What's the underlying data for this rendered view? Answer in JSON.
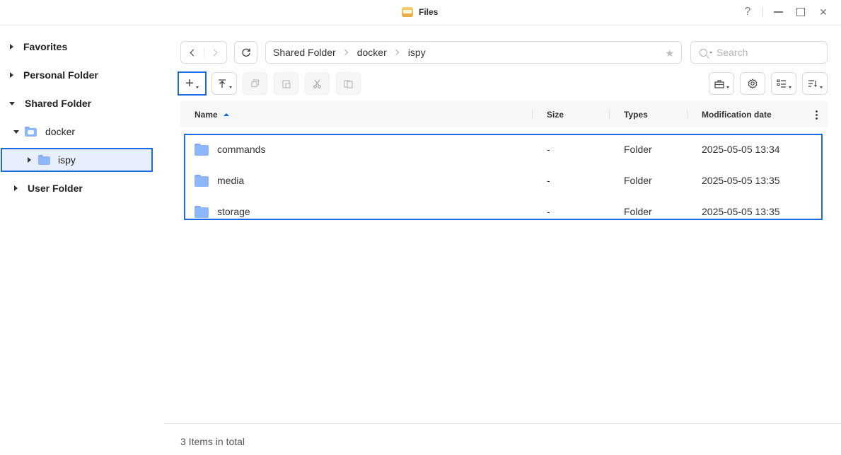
{
  "window": {
    "title": "Files",
    "help": "?",
    "close": "✕"
  },
  "sidebar": {
    "items": [
      {
        "label": "Favorites"
      },
      {
        "label": "Personal Folder"
      },
      {
        "label": "Shared Folder"
      },
      {
        "label": "docker"
      },
      {
        "label": "ispy"
      },
      {
        "label": "User Folder"
      }
    ]
  },
  "toolbar": {
    "path": [
      "Shared Folder",
      "docker",
      "ispy"
    ],
    "search_placeholder": "Search",
    "create_label": "+"
  },
  "table": {
    "columns": [
      "Name",
      "Size",
      "Types",
      "Modification date"
    ],
    "rows": [
      {
        "name": "commands",
        "size": "-",
        "type": "Folder",
        "modified": "2025-05-05 13:34"
      },
      {
        "name": "media",
        "size": "-",
        "type": "Folder",
        "modified": "2025-05-05 13:35"
      },
      {
        "name": "storage",
        "size": "-",
        "type": "Folder",
        "modified": "2025-05-05 13:35"
      }
    ]
  },
  "status": {
    "total": "3 Items in total"
  },
  "colors": {
    "accent": "#1a6be0",
    "folder": "#8eb6fb",
    "selected_bg": "#e7effc"
  }
}
